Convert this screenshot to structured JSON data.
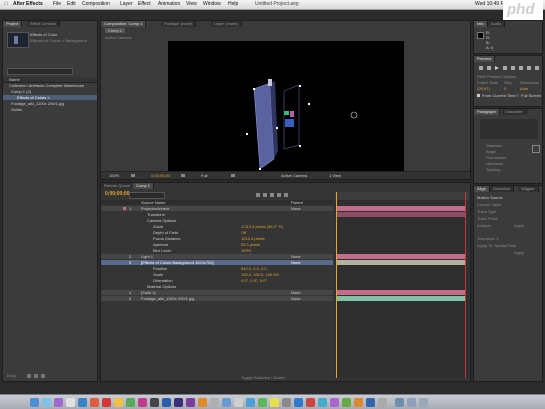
{
  "menubar": {
    "app": "After Effects",
    "items": [
      "File",
      "Edit",
      "Composition",
      "Layer",
      "Effect",
      "Animation",
      "View",
      "Window",
      "Help"
    ],
    "doc_title": "Untitled Project.aep",
    "clock": "Wed 10:49 PM"
  },
  "brand": {
    "logo_text": "phd",
    "logo_color": "#e8452a"
  },
  "project_panel": {
    "tab_project": "Project",
    "tab_effect_controls": "Effect Controls",
    "footage_name": "Effects of Color",
    "footage_info": "Ellipses of Colors × Background",
    "search_placeholder": "",
    "column_name": "Name",
    "items": [
      "Collection: Artefacts Complete Warehouse",
      "Comp 1 (2)",
      "Effects of Colors ×",
      "Footage_aiki_1100x 200/1.jpg",
      "Solids"
    ],
    "bpc": "8 bpc"
  },
  "comp_panel": {
    "tab_comp": "Composition: Comp 1",
    "tab_footage": "Footage: (none)",
    "tab_layer": "Layer: (none)",
    "comp_label": "Comp 1",
    "zoom": "100%",
    "timecode": "0;00;00;00",
    "resolution": "Full",
    "camera": "Active Camera",
    "views": "1 View"
  },
  "timeline": {
    "tab_render": "Render Queue",
    "tab_comp": "Comp 1",
    "timecode": "0;00;00;00",
    "col_source": "Source Name",
    "col_parent": "Parent",
    "layers": [
      {
        "num": "1",
        "name": "Projector/Inherit",
        "parent": "None",
        "color": "#c26d8c"
      },
      {
        "num": "",
        "name": "Transform",
        "parent": "",
        "color": ""
      },
      {
        "num": "",
        "name": "Camera Options",
        "parent": "",
        "color": ""
      },
      {
        "num": "",
        "name": "Zoom",
        "value": "1,013.3 pixels (36.2° H)",
        "color": ""
      },
      {
        "num": "",
        "name": "Depth of Field",
        "value": "Off",
        "color": ""
      },
      {
        "num": "",
        "name": "Focus Distance",
        "value": "1013.3 pixels",
        "color": ""
      },
      {
        "num": "",
        "name": "Aperture",
        "value": "25.3 pixels",
        "color": ""
      },
      {
        "num": "",
        "name": "Blur Level",
        "value": "100%",
        "color": ""
      },
      {
        "num": "2",
        "name": "Light 1",
        "parent": "None",
        "color": "#c26d8c"
      },
      {
        "num": "3",
        "name": "[Effects of Colors Background 1024x700]",
        "parent": "None",
        "color": "#b3b09d"
      },
      {
        "num": "",
        "name": "Position",
        "value": "512.0, 0.0, 0.0",
        "color": ""
      },
      {
        "num": "",
        "name": "Scale",
        "value": "100.0, 100.0, 100.0%",
        "color": ""
      },
      {
        "num": "",
        "name": "Orientation",
        "value": "0.0°, 0.0°, 0.0°",
        "color": ""
      },
      {
        "num": "",
        "name": "Material Options",
        "parent": "",
        "color": ""
      },
      {
        "num": "4",
        "name": "[Solid 1]",
        "parent": "None",
        "color": "#c26d8c"
      },
      {
        "num": "5",
        "name": "Footage_aiki_1100x 200/1.jpg",
        "parent": "None",
        "color": "#7fc4a4"
      }
    ],
    "footer": "Toggle Switches / Modes"
  },
  "right_panels": {
    "tab_info": "Info",
    "tab_audio": "Audio",
    "tab_preview": "Preview",
    "tab_effects": "Effects & Presets",
    "info_lines": [
      "R:",
      "G:",
      "B:",
      "A: 0"
    ],
    "preview_label": "RAM Preview Options",
    "frame_rate_label": "Frame Rate",
    "skip_label": "Skip",
    "resolution_label": "Resolution",
    "frame_rate": "(29.97)",
    "skip": "0",
    "resolution": "Auto",
    "from_current": "From Current Time",
    "full_screen": "Full Screen",
    "tab_align": "Align",
    "tab_smoother": "Smoother",
    "tab_wiggler": "Wiggler",
    "tab_motion": "Motion Sketch",
    "tab_paragraph": "Paragraph",
    "tab_character": "Character",
    "brush_labels": [
      "Diameter",
      "Angle",
      "Roundness",
      "Hardness",
      "Spacing"
    ],
    "motion_labels": [
      "Motion Source",
      "Current Value",
      "Track Type",
      "Track Point",
      "Analyze",
      "Apply"
    ],
    "smoother_values": [
      "Tolerance: 1",
      "Apply To: Spatial Path",
      "Apply"
    ]
  },
  "colors": {
    "accent": "#e6a42a",
    "panel": "#3b3b3b",
    "bg": "#2b2b2b"
  }
}
